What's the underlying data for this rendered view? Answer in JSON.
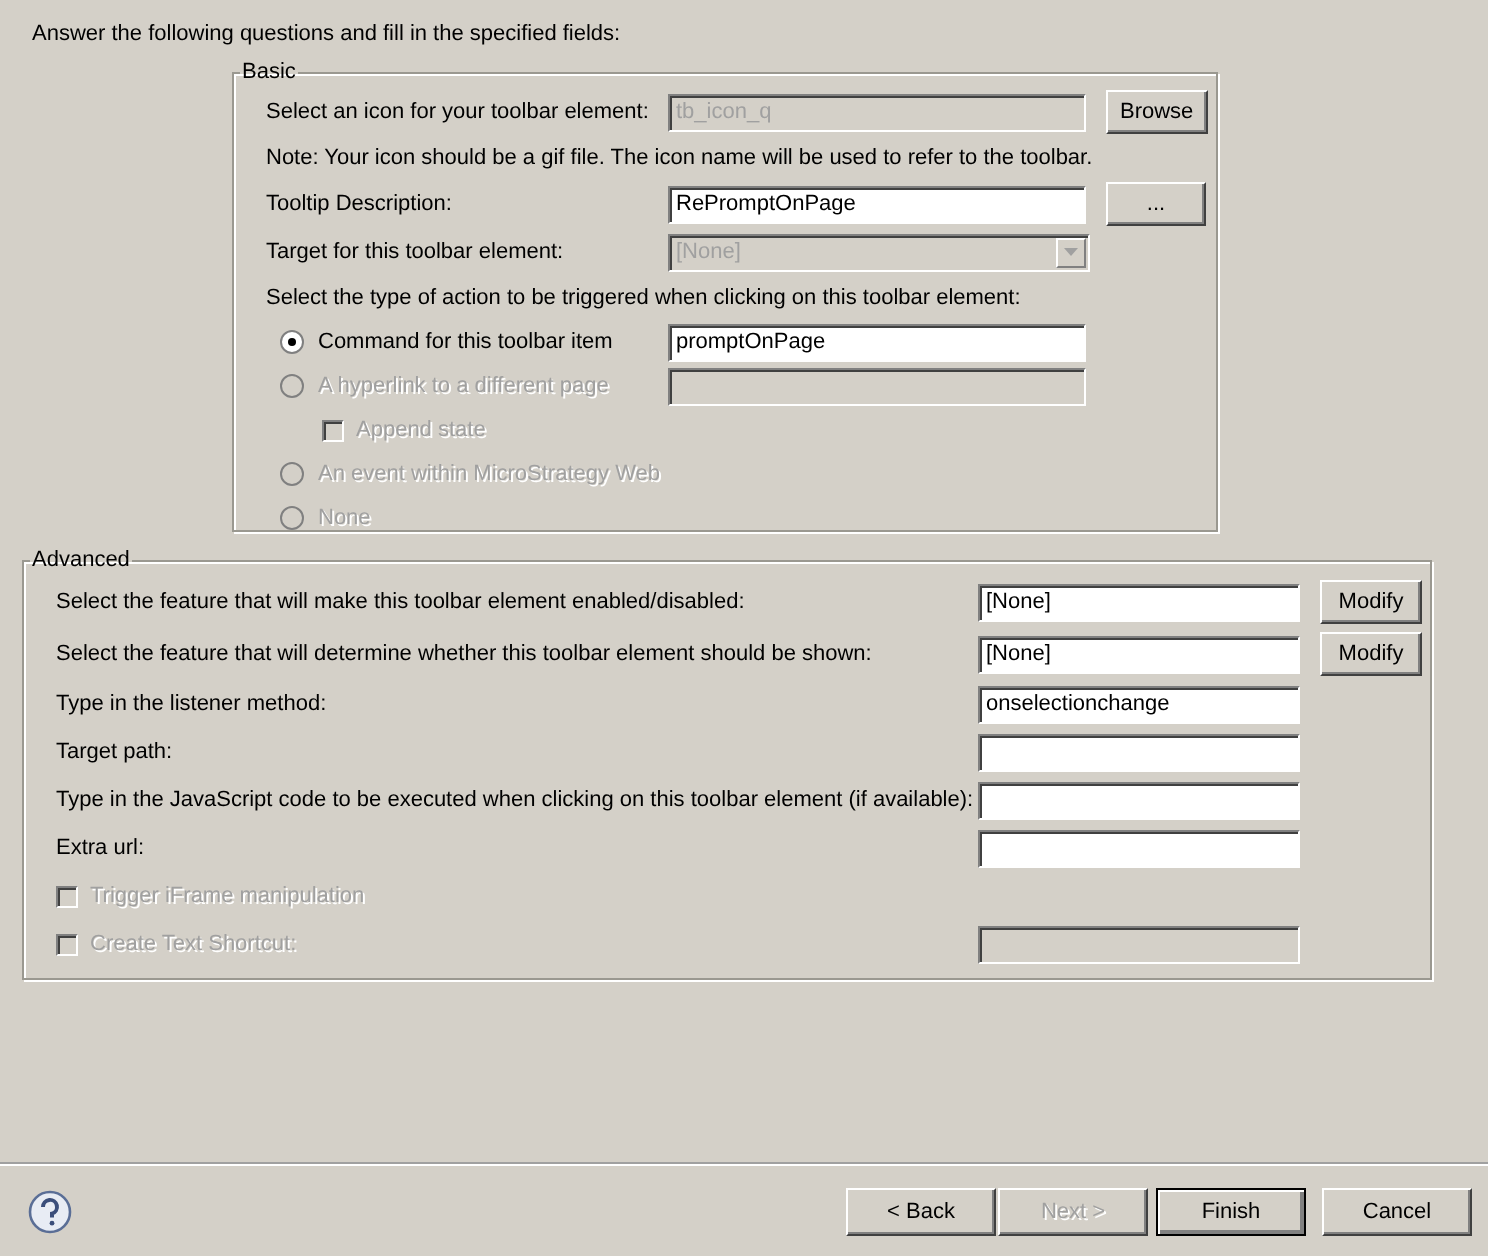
{
  "instruction": "Answer the following questions and fill in the specified fields:",
  "basic": {
    "legend": "Basic",
    "rows": [
      {
        "kind": "field",
        "label": "Select an icon for your toolbar element:",
        "value": "tb_icon_q",
        "disabled": true,
        "button": "Browse"
      },
      {
        "kind": "note",
        "text": "Note: Your icon should be a gif file. The icon name will be used to refer to the toolbar."
      },
      {
        "kind": "field",
        "label": "Tooltip Description:",
        "value": "RePromptOnPage",
        "disabled": false,
        "button": "..."
      },
      {
        "kind": "dropdown",
        "label": "Target for this toolbar element:",
        "value": "[None]",
        "disabled": true
      },
      {
        "kind": "note",
        "text": "Select the type of action to be triggered when clicking on this toolbar element:"
      },
      {
        "kind": "radio",
        "label": "Command for this toolbar item",
        "selected": true,
        "disabled": false,
        "field": {
          "value": "promptOnPage",
          "disabled": false
        }
      },
      {
        "kind": "radio",
        "label": "A hyperlink to a different page",
        "selected": false,
        "disabled": true,
        "field": {
          "disabled": true
        }
      },
      {
        "kind": "checkbox",
        "label": "Append state",
        "checked": false,
        "disabled": true
      },
      {
        "kind": "radio",
        "label": "An event within MicroStrategy Web",
        "selected": false,
        "disabled": true
      },
      {
        "kind": "radio",
        "label": "None",
        "selected": false,
        "disabled": true
      }
    ]
  },
  "advanced": {
    "legend": "Advanced",
    "rows": [
      {
        "kind": "field",
        "label": "Select the feature that will make this toolbar element enabled/disabled:",
        "value": "[None]",
        "disabled": false,
        "button": "Modify"
      },
      {
        "kind": "field",
        "label": "Select the feature that will determine whether this toolbar element should be shown:",
        "value": "[None]",
        "disabled": false,
        "button": "Modify"
      },
      {
        "kind": "field",
        "label": "Type in the listener method:",
        "value": "onselectionchange",
        "disabled": false
      },
      {
        "kind": "field",
        "label": "Target path:",
        "disabled": false
      },
      {
        "kind": "field",
        "label": "Type in the JavaScript code to be executed when clicking on this toolbar element (if available):",
        "disabled": false
      },
      {
        "kind": "field",
        "label": "Extra url:",
        "disabled": false
      },
      {
        "kind": "checkbox",
        "label": "Trigger iFrame manipulation",
        "checked": false,
        "disabled": true
      },
      {
        "kind": "checkbox",
        "label": "Create Text Shortcut:",
        "checked": false,
        "disabled": true,
        "field": {
          "disabled": true
        }
      }
    ]
  },
  "buttons": [
    {
      "label": "< Back",
      "disabled": false,
      "default": false
    },
    {
      "label": "Next >",
      "disabled": true,
      "default": false
    },
    {
      "label": "Finish",
      "disabled": false,
      "default": true
    },
    {
      "label": "Cancel",
      "disabled": false,
      "default": false
    }
  ]
}
